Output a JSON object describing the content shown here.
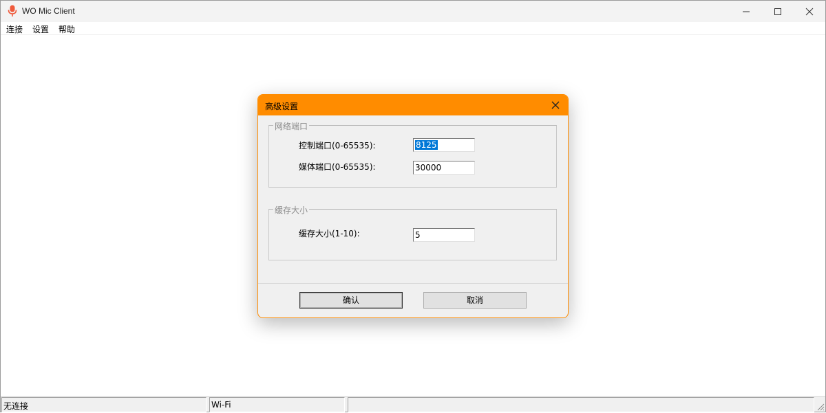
{
  "window": {
    "title": "WO Mic Client",
    "menu": [
      "连接",
      "设置",
      "帮助"
    ]
  },
  "status_bar": {
    "connection": "无连接",
    "transport": "Wi-Fi",
    "extra": ""
  },
  "dialog": {
    "title": "高级设置",
    "network_group": {
      "legend": "网络端口",
      "control_port_label": "控制端口(0-65535):",
      "control_port_value": "8125",
      "media_port_label": "媒体端口(0-65535):",
      "media_port_value": "30000"
    },
    "buffer_group": {
      "legend": "缓存大小",
      "buffer_label": "缓存大小(1-10):",
      "buffer_value": "5"
    },
    "ok_label": "确认",
    "cancel_label": "取消"
  },
  "colors": {
    "accent": "#ff8c00",
    "selection": "#0078d7"
  },
  "icons": {
    "app": "microphone-icon",
    "minimize": "minimize-icon",
    "maximize": "maximize-icon",
    "close": "close-icon",
    "dialog_close": "close-icon",
    "grip": "resize-grip-icon"
  }
}
